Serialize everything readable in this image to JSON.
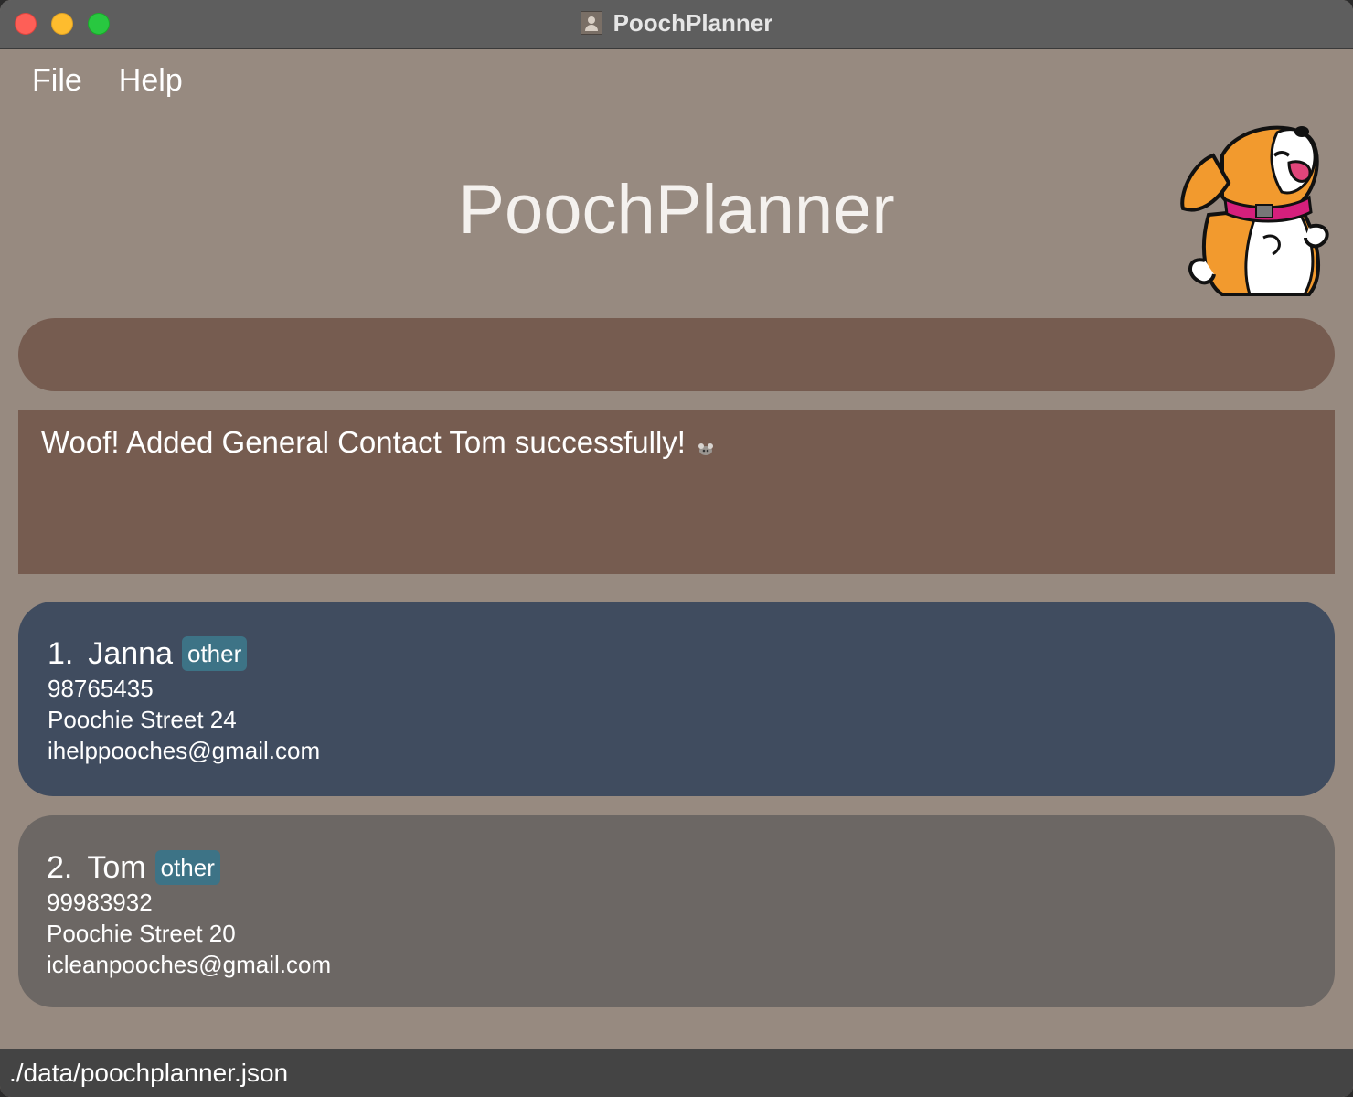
{
  "window": {
    "title": "PoochPlanner"
  },
  "menu": {
    "file": "File",
    "help": "Help"
  },
  "header": {
    "title": "PoochPlanner"
  },
  "command_box": {
    "value": "",
    "placeholder": ""
  },
  "result": {
    "message": "Woof! Added General Contact Tom successfully!"
  },
  "contacts": [
    {
      "index": "1.",
      "name": "Janna",
      "tag": "other",
      "phone": "98765435",
      "address": "Poochie Street 24",
      "email": "ihelppooches@gmail.com",
      "selected": true
    },
    {
      "index": "2.",
      "name": "Tom",
      "tag": "other",
      "phone": "99983932",
      "address": "Poochie Street 20",
      "email": "icleanpooches@gmail.com",
      "selected": false
    }
  ],
  "status_bar": {
    "path": "./data/poochplanner.json"
  },
  "colors": {
    "background": "#978a80",
    "command_box": "#765c50",
    "selected_card": "#404c5f",
    "card": "#6c6764",
    "tag": "#3d7386",
    "status_bar": "#444444"
  },
  "icons": {
    "mascot": "dog-mascot-icon",
    "result_emoji": "paw-icon"
  }
}
